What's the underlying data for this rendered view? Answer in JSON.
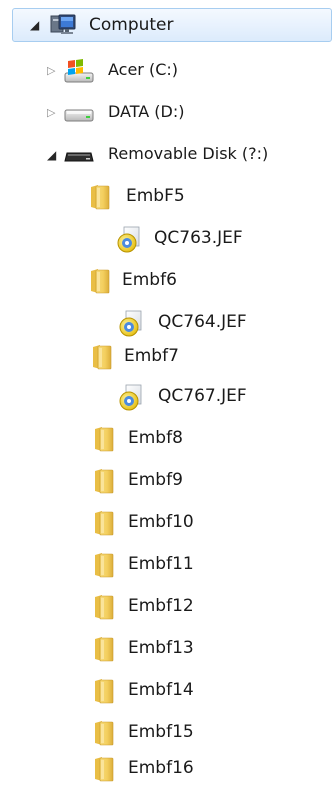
{
  "tree": {
    "computer": {
      "label": "Computer"
    },
    "drives": [
      {
        "label": "Acer (C:)"
      },
      {
        "label": "DATA (D:)"
      },
      {
        "label": "Removable Disk (?:)"
      }
    ],
    "folders": [
      {
        "label": "EmbF5",
        "file": "QC763.JEF"
      },
      {
        "label": "Embf6",
        "file": "QC764.JEF"
      },
      {
        "label": "Embf7",
        "file": "QC767.JEF"
      },
      {
        "label": "Embf8"
      },
      {
        "label": "Embf9"
      },
      {
        "label": "Embf10"
      },
      {
        "label": "Embf11"
      },
      {
        "label": "Embf12"
      },
      {
        "label": "Embf13"
      },
      {
        "label": "Embf14"
      },
      {
        "label": "Embf15"
      },
      {
        "label": "Embf16"
      }
    ]
  },
  "icons": {
    "expanded": "expanded-arrow-icon",
    "collapsed": "collapsed-arrow-icon",
    "computer": "computer-icon",
    "windows_drive": "windows-drive-icon",
    "drive": "hard-drive-icon",
    "removable": "removable-drive-icon",
    "folder": "folder-icon",
    "file": "jef-file-icon"
  },
  "colors": {
    "selection_top": "#f4f9ff",
    "selection_bottom": "#dcebfc",
    "selection_border": "#a7cdf0",
    "folder": "#f2cc62"
  }
}
